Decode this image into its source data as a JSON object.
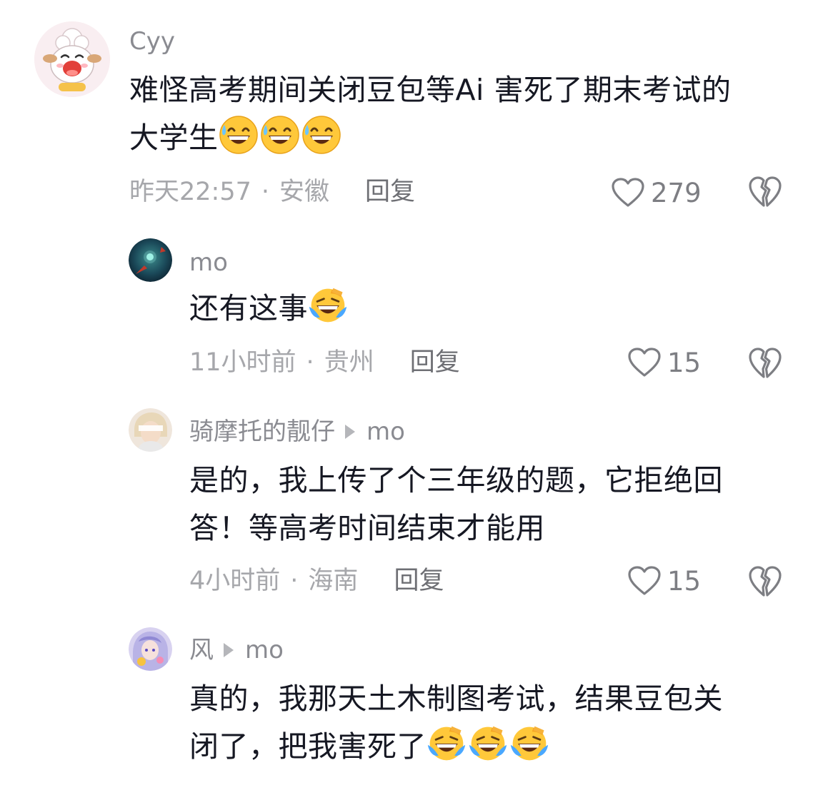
{
  "comments": [
    {
      "username": "Cyy",
      "reply_to": "",
      "text": "难怪高考期间关闭豆包等Ai 害死了期末考试的大学生",
      "text_line1": "难怪高考期间关闭豆包等Ai 害死了期末考试的",
      "text_line2": "大学生",
      "emojis": [
        "grin-sweat-emoji",
        "grin-sweat-emoji",
        "grin-sweat-emoji"
      ],
      "time": "昨天22:57",
      "location": "安徽",
      "reply_label": "回复",
      "likes": "279"
    },
    {
      "username": "mo",
      "reply_to": "",
      "text_line1": "还有这事",
      "emojis": [
        "laugh-cry-emoji"
      ],
      "time": "11小时前",
      "location": "贵州",
      "reply_label": "回复",
      "likes": "15"
    },
    {
      "username": "骑摩托的靓仔",
      "reply_to": "mo",
      "text_line1": "是的，我上传了个三年级的题，它拒绝回",
      "text_line2": "答！等高考时间结束才能用",
      "time": "4小时前",
      "location": "海南",
      "reply_label": "回复",
      "likes": "15"
    },
    {
      "username": "风",
      "reply_to": "mo",
      "text_line1": "真的，我那天土木制图考试，结果豆包关",
      "text_line2": "闭了，把我害死了",
      "emojis": [
        "laugh-cry-emoji",
        "laugh-cry-emoji",
        "laugh-cry-emoji"
      ]
    }
  ],
  "separator": "·",
  "colors": {
    "username": "#8a8b91",
    "body": "#161823",
    "meta": "#a6a7ab",
    "reply": "#6e6f74",
    "icon": "#7d7e83"
  }
}
